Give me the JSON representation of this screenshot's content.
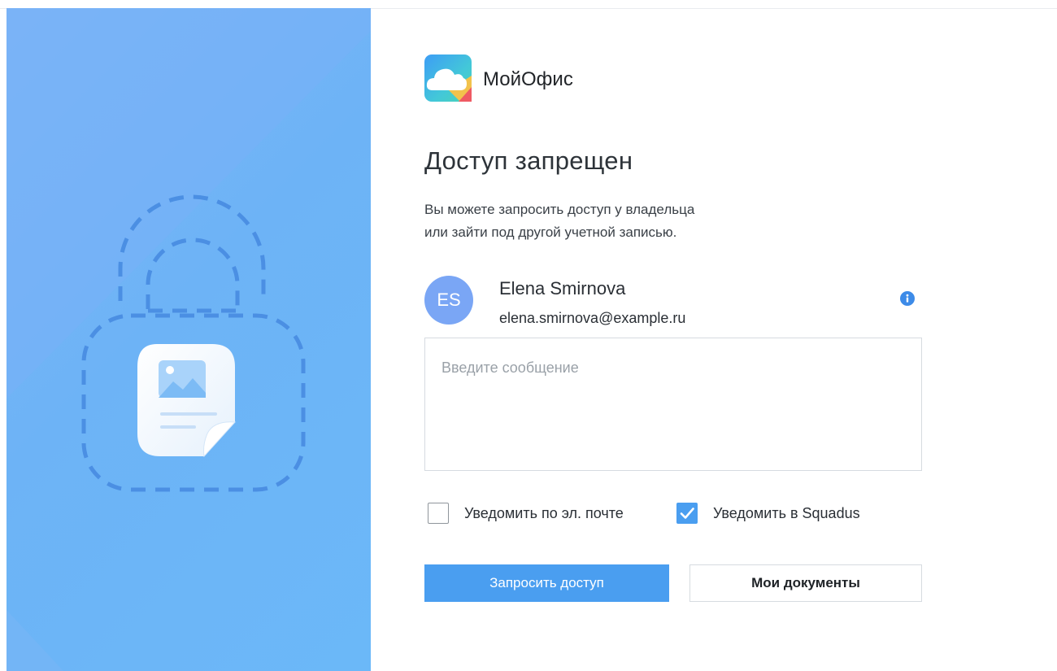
{
  "brand": {
    "name": "МойОфис"
  },
  "page": {
    "title": "Доступ запрещен",
    "description_line1": "Вы можете запросить доступ у владельца",
    "description_line2": "или зайти под другой учетной записью."
  },
  "user": {
    "initials": "ES",
    "name": "Elena Smirnova",
    "email": "elena.smirnova@example.ru"
  },
  "message": {
    "placeholder": "Введите сообщение",
    "value": ""
  },
  "options": [
    {
      "label": "Уведомить по эл. почте",
      "checked": false
    },
    {
      "label": "Уведомить в Squadus",
      "checked": true
    }
  ],
  "actions": {
    "request_label": "Запросить доступ",
    "documents_label": "Мои документы"
  },
  "icons": {
    "logo": "cloud-logo-icon",
    "lock": "lock-dashed-icon",
    "document": "image-document-icon",
    "info": "info-icon",
    "check": "check-icon"
  },
  "colors": {
    "accent": "#4a9ef0",
    "avatar": "#7aa6f5",
    "panel": "#6db3f6",
    "info": "#3d8be8"
  }
}
